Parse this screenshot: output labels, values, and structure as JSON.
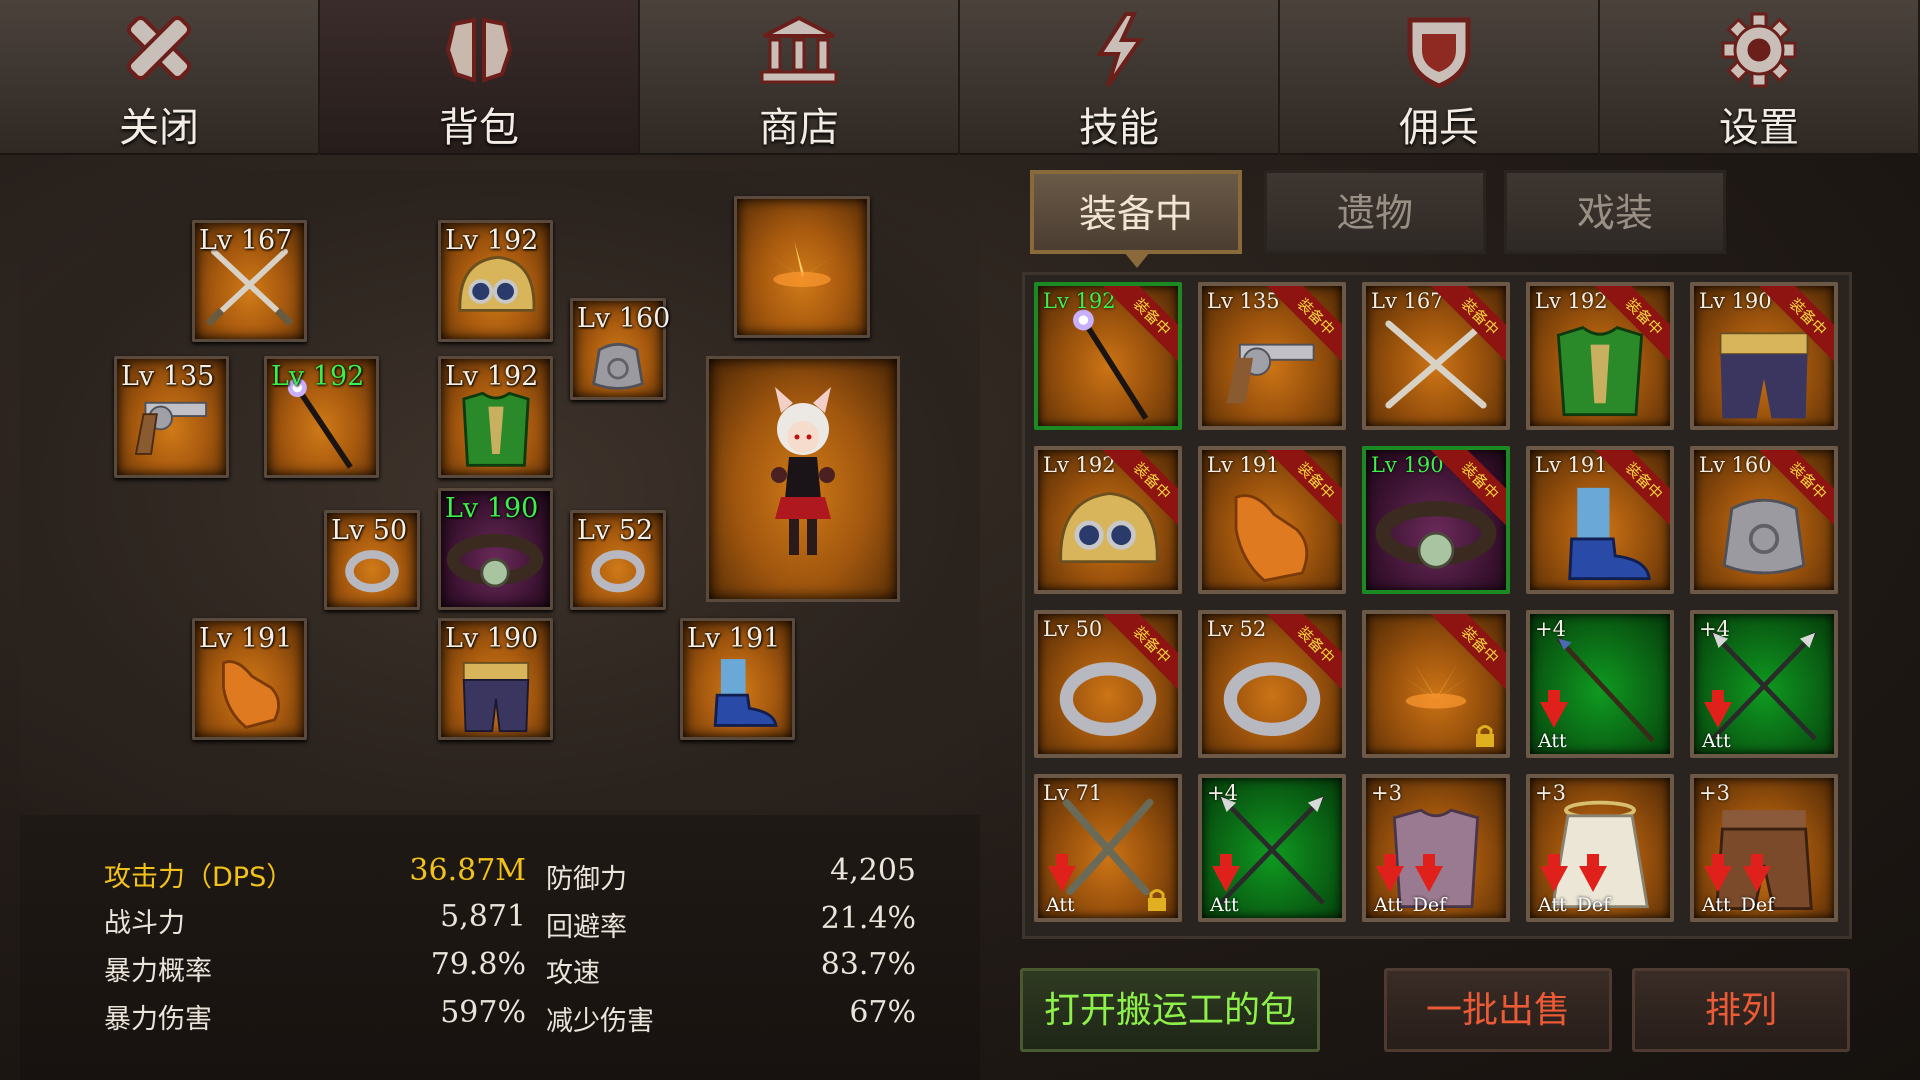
{
  "nav": [
    {
      "label": "关闭",
      "icon": "close-icon"
    },
    {
      "label": "背包",
      "icon": "backpack-icon"
    },
    {
      "label": "商店",
      "icon": "shop-icon"
    },
    {
      "label": "技能",
      "icon": "skill-icon"
    },
    {
      "label": "佣兵",
      "icon": "mercenary-icon"
    },
    {
      "label": "设置",
      "icon": "gear-icon"
    }
  ],
  "equipment": {
    "weapon2": "Lv 167",
    "helmet": "Lv 192",
    "cape": "Lv 160",
    "gun": "Lv 135",
    "staff": "Lv 192",
    "armor": "Lv 192",
    "ring1": "Lv 50",
    "belt": "Lv 190",
    "ring2": "Lv 52",
    "gloves": "Lv 191",
    "pants": "Lv 190",
    "boots": "Lv 191"
  },
  "stats": {
    "attack_label": "攻击力（DPS）",
    "attack_value": "36.87M",
    "power_label": "战斗力",
    "power_value": "5,871",
    "crit_rate_label": "暴力概率",
    "crit_rate_value": "79.8%",
    "crit_dmg_label": "暴力伤害",
    "crit_dmg_value": "597%",
    "defense_label": "防御力",
    "defense_value": "4,205",
    "evasion_label": "回避率",
    "evasion_value": "21.4%",
    "atk_speed_label": "攻速",
    "atk_speed_value": "83.7%",
    "dmg_reduce_label": "减少伤害",
    "dmg_reduce_value": "67%"
  },
  "filters": {
    "equipped": "装备中",
    "relics": "遗物",
    "costume": "戏装"
  },
  "badge_text": "装备中",
  "grid": {
    "r0": [
      "Lv 192",
      "Lv 135",
      "Lv 167",
      "Lv 192",
      "Lv 190"
    ],
    "r1": [
      "Lv 192",
      "Lv 191",
      "Lv 190",
      "Lv 191",
      "Lv 160"
    ],
    "r2": [
      "Lv 50",
      "Lv 52",
      "",
      "+4",
      "+4"
    ],
    "r3": [
      "Lv 71",
      "+4",
      "+3",
      "+3",
      "+3"
    ]
  },
  "tags": {
    "att": "Att",
    "def": "Def"
  },
  "buttons": {
    "porter_bag": "打开搬运工的包",
    "bulk_sell": "一批出售",
    "sort": "排列"
  },
  "colors": {
    "level_green": "#3cf04a",
    "attack_gold": "#f2c21a",
    "badge_red": "#8e1412",
    "button_green": "#8ef04a",
    "button_red": "#ec5a36"
  }
}
